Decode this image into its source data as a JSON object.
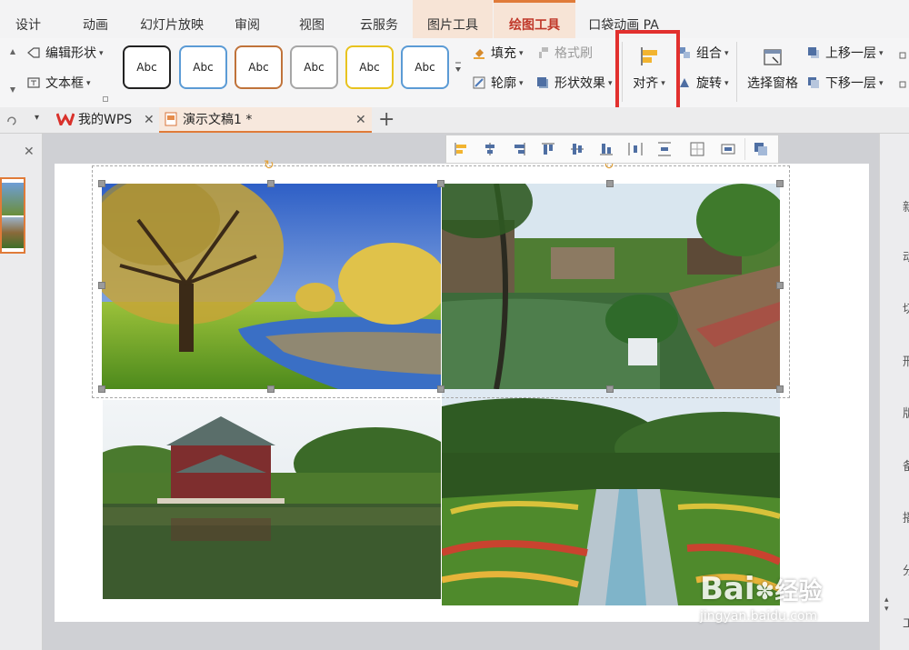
{
  "menu_tabs": [
    "设计",
    "动画",
    "幻灯片放映",
    "审阅",
    "视图",
    "云服务",
    "图片工具",
    "绘图工具",
    "口袋动画 PA"
  ],
  "ribbon": {
    "edit_shape": "编辑形状",
    "text_box": "文本框",
    "style_swatch_label": "Abc",
    "fill": "填充",
    "format_painter": "格式刷",
    "outline": "轮廓",
    "shape_effects": "形状效果",
    "align": "对齐",
    "group": "组合",
    "rotate": "旋转",
    "selection_pane": "选择窗格",
    "bring_forward": "上移一层",
    "send_backward": "下移一层"
  },
  "style_swatch_colors": [
    "#222222",
    "#5b9bd5",
    "#c0733a",
    "#a6a6a6",
    "#e8c31f",
    "#5b9bd5"
  ],
  "doc_tabs": {
    "wps_home": "我的WPS",
    "document": "演示文稿1 *"
  },
  "watermark": {
    "brand": "Bai",
    "brand_suffix": "经验",
    "url": "jingyan.baidu.com"
  },
  "right_panel_chars": [
    "新",
    "动",
    "切",
    "形",
    "版",
    "备",
    "播",
    "分",
    "工"
  ],
  "colors": {
    "accent_tab": "#f7e4d6",
    "active_tab_text": "#c0392b",
    "highlight_box": "#e2302e"
  }
}
